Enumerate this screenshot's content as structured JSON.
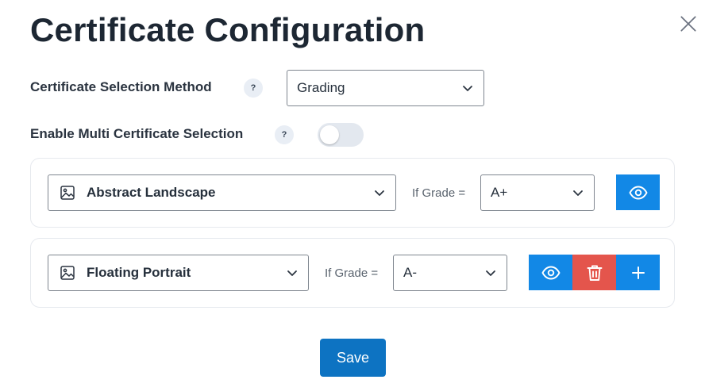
{
  "modal": {
    "title": "Certificate Configuration"
  },
  "selection_method": {
    "label": "Certificate Selection Method",
    "help": "?",
    "value": "Grading"
  },
  "multi_selection": {
    "label": "Enable Multi Certificate Selection",
    "help": "?",
    "enabled": false
  },
  "certificates": [
    {
      "name": "Abstract Landscape",
      "condition_label": "If Grade =",
      "grade": "A+"
    },
    {
      "name": "Floating Portrait",
      "condition_label": "If Grade =",
      "grade": "A-"
    }
  ],
  "footer": {
    "save_label": "Save"
  },
  "colors": {
    "primary": "#1288e6",
    "danger": "#e4554c",
    "save": "#0d73c2"
  },
  "icons": [
    "close-icon",
    "help-icon",
    "chevron-down-icon",
    "image-icon",
    "eye-icon",
    "trash-icon",
    "plus-icon"
  ]
}
